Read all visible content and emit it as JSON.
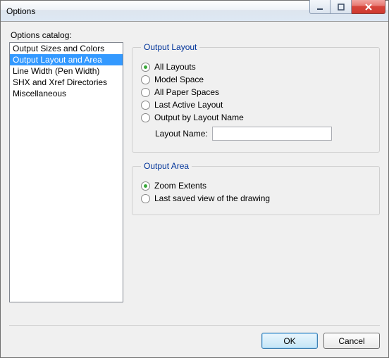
{
  "window": {
    "title": "Options"
  },
  "catalog": {
    "label": "Options catalog:",
    "items": [
      {
        "label": "Output Sizes and Colors"
      },
      {
        "label": "Output Layout and Area"
      },
      {
        "label": "Line Width (Pen Width)"
      },
      {
        "label": "SHX and Xref Directories"
      },
      {
        "label": "Miscellaneous"
      }
    ],
    "selected_index": 1
  },
  "output_layout": {
    "legend": "Output Layout",
    "options": {
      "all_layouts": "All Layouts",
      "model_space": "Model Space",
      "all_paper_spaces": "All Paper Spaces",
      "last_active_layout": "Last Active Layout",
      "output_by_layout_name": "Output by Layout Name"
    },
    "selected": "all_layouts",
    "layout_name_label": "Layout Name:",
    "layout_name_value": ""
  },
  "output_area": {
    "legend": "Output Area",
    "options": {
      "zoom_extents": "Zoom Extents",
      "last_saved_view": "Last saved view of the drawing"
    },
    "selected": "zoom_extents"
  },
  "buttons": {
    "ok": "OK",
    "cancel": "Cancel"
  }
}
